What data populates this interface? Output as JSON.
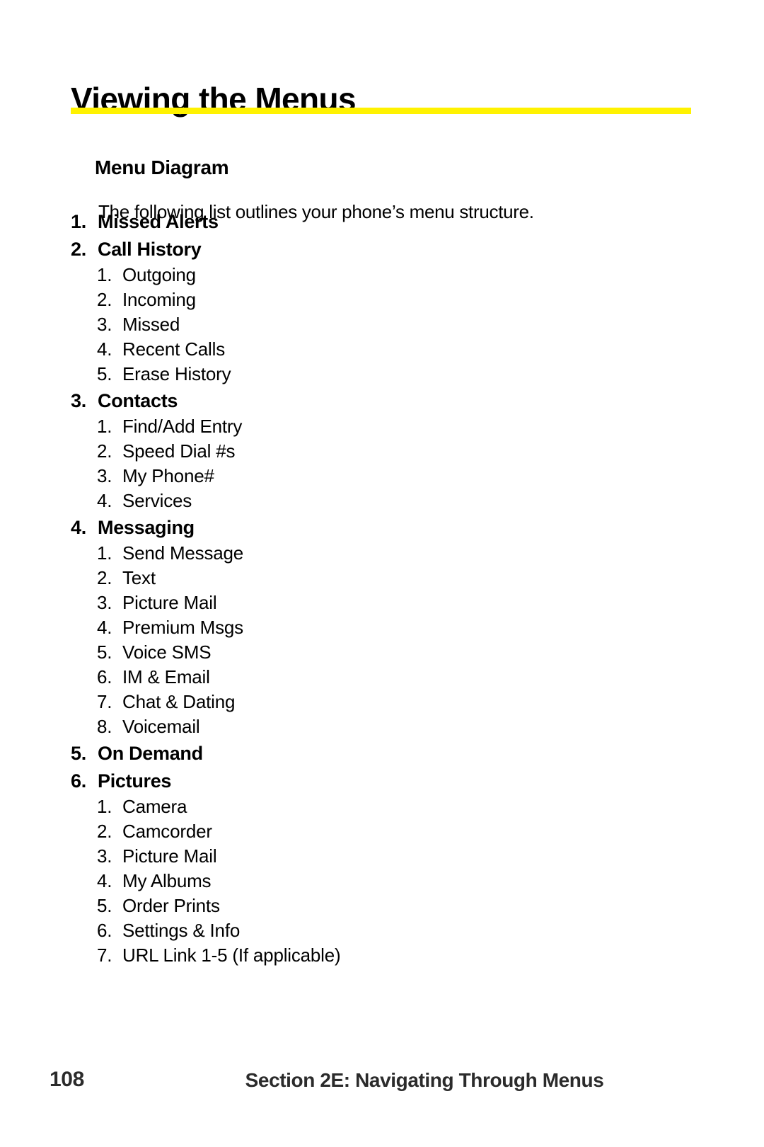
{
  "document": {
    "title": "Viewing the Menus",
    "accent_color": "#fff200",
    "section_heading": "Menu Diagram",
    "intro_text": "The following list outlines your phone’s menu structure."
  },
  "menu": [
    {
      "number": "1.",
      "label": "Missed Alerts",
      "items": []
    },
    {
      "number": "2.",
      "label": "Call History",
      "items": [
        {
          "number": "1.",
          "label": "Outgoing"
        },
        {
          "number": "2.",
          "label": "Incoming"
        },
        {
          "number": "3.",
          "label": "Missed"
        },
        {
          "number": "4.",
          "label": "Recent Calls"
        },
        {
          "number": "5.",
          "label": "Erase History"
        }
      ]
    },
    {
      "number": "3.",
      "label": "Contacts",
      "items": [
        {
          "number": "1.",
          "label": "Find/Add Entry"
        },
        {
          "number": "2.",
          "label": "Speed Dial #s"
        },
        {
          "number": "3.",
          "label": "My Phone#"
        },
        {
          "number": "4.",
          "label": "Services"
        }
      ]
    },
    {
      "number": "4.",
      "label": "Messaging",
      "items": [
        {
          "number": "1.",
          "label": "Send Message"
        },
        {
          "number": "2.",
          "label": "Text"
        },
        {
          "number": "3.",
          "label": "Picture Mail"
        },
        {
          "number": "4.",
          "label": "Premium Msgs"
        },
        {
          "number": "5.",
          "label": "Voice SMS"
        },
        {
          "number": "6.",
          "label": "IM & Email"
        },
        {
          "number": "7.",
          "label": "Chat & Dating"
        },
        {
          "number": "8.",
          "label": "Voicemail"
        }
      ]
    },
    {
      "number": "5.",
      "label": "On Demand",
      "items": []
    },
    {
      "number": "6.",
      "label": "Pictures",
      "items": [
        {
          "number": "1.",
          "label": "Camera"
        },
        {
          "number": "2.",
          "label": "Camcorder"
        },
        {
          "number": "3.",
          "label": "Picture Mail"
        },
        {
          "number": "4.",
          "label": "My Albums"
        },
        {
          "number": "5.",
          "label": "Order Prints"
        },
        {
          "number": "6.",
          "label": "Settings & Info"
        },
        {
          "number": "7.",
          "label": "URL Link 1-5 (If applicable)"
        }
      ]
    }
  ],
  "footer": {
    "page_number": "108",
    "section_label": "Section 2E: Navigating Through Menus"
  }
}
